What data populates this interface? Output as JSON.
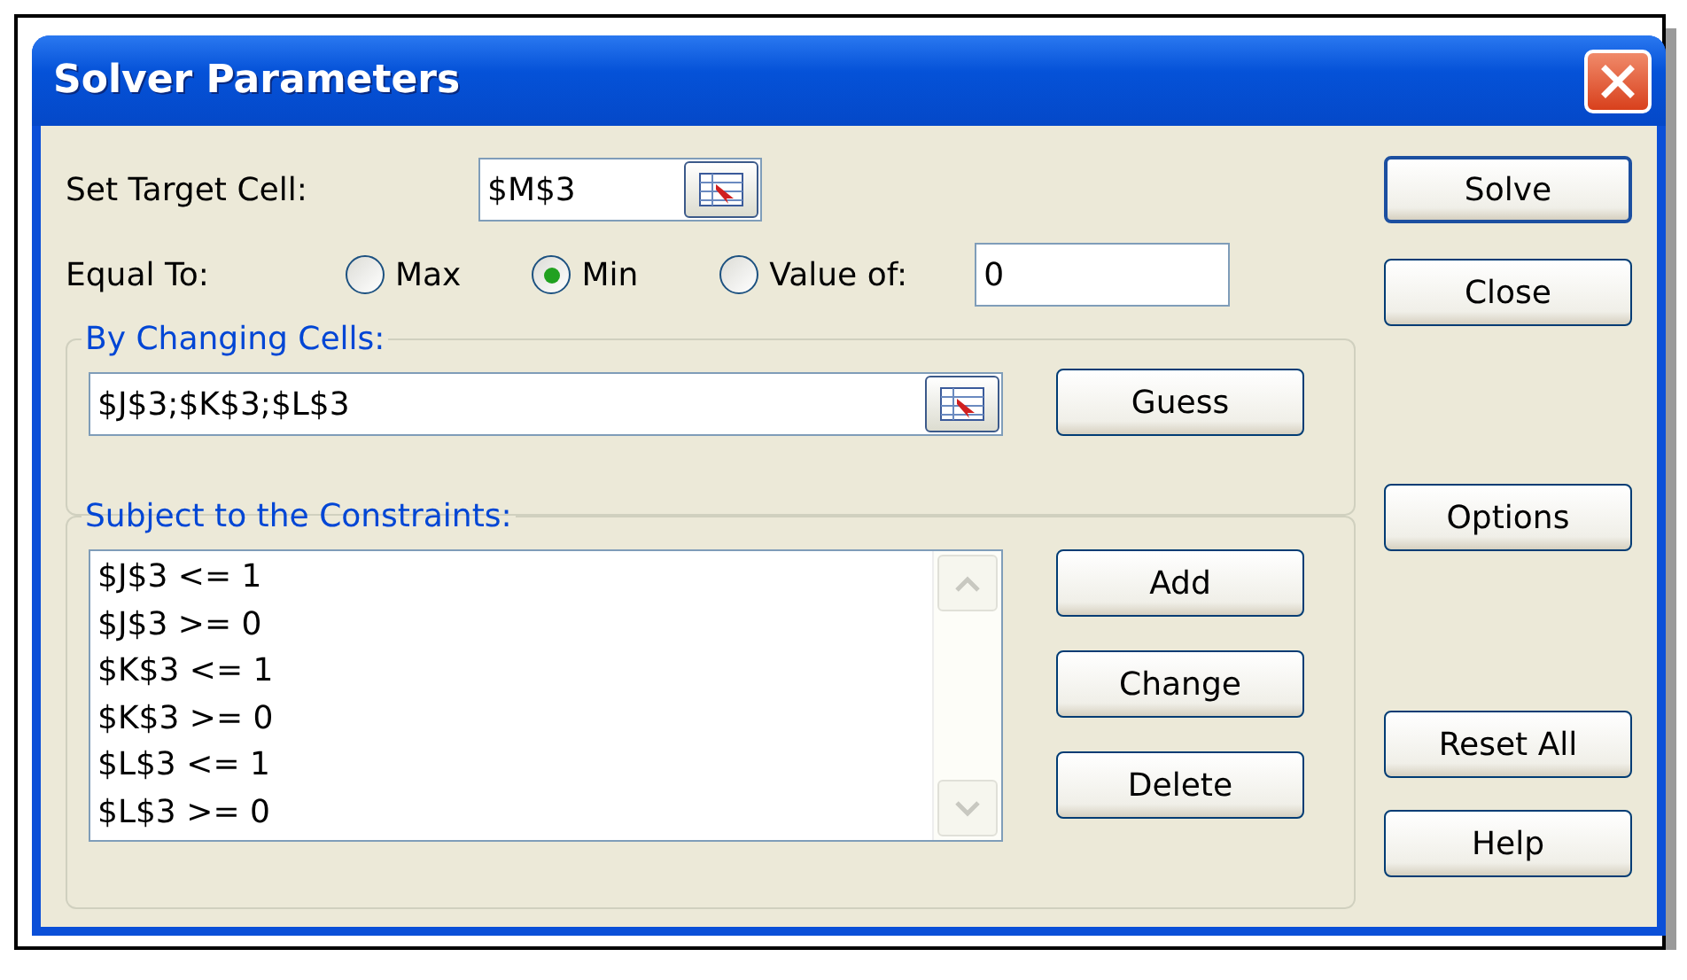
{
  "window": {
    "title": "Solver Parameters"
  },
  "target": {
    "label": "Set Target Cell:",
    "value": "$M$3"
  },
  "equal_to": {
    "label": "Equal To:",
    "options": [
      {
        "label": "Max",
        "selected": false
      },
      {
        "label": "Min",
        "selected": true
      },
      {
        "label": "Value of:",
        "selected": false
      }
    ],
    "value": "0"
  },
  "changing_cells": {
    "legend": "By Changing Cells:",
    "value": "$J$3;$K$3;$L$3",
    "button": {
      "label": "Guess"
    }
  },
  "constraints": {
    "legend": "Subject to the Constraints:",
    "items": [
      "$J$3 <= 1",
      "$J$3 >= 0",
      "$K$3 <= 1",
      "$K$3 >= 0",
      "$L$3 <= 1",
      "$L$3 >= 0"
    ],
    "buttons": [
      {
        "label": "Add"
      },
      {
        "label": "Change"
      },
      {
        "label": "Delete"
      }
    ]
  },
  "side_buttons": [
    {
      "label": "Solve",
      "default": true
    },
    {
      "label": "Close",
      "default": false
    },
    {
      "label": "Options",
      "default": false
    },
    {
      "label": "Reset All",
      "default": false
    },
    {
      "label": "Help",
      "default": false
    }
  ]
}
